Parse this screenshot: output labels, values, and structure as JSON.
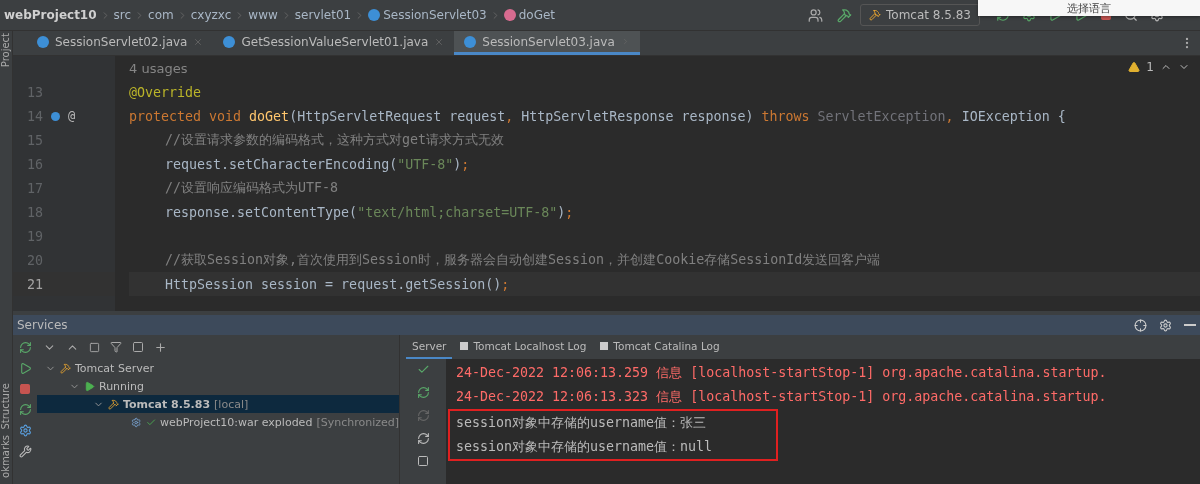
{
  "breadcrumbs": [
    {
      "label": "webProject10",
      "kind": "project"
    },
    {
      "label": "src",
      "kind": "folder"
    },
    {
      "label": "com",
      "kind": "folder"
    },
    {
      "label": "cxyzxc",
      "kind": "folder"
    },
    {
      "label": "www",
      "kind": "folder"
    },
    {
      "label": "servlet01",
      "kind": "folder"
    },
    {
      "label": "SessionServlet03",
      "kind": "class"
    },
    {
      "label": "doGet",
      "kind": "method"
    }
  ],
  "run_config": "Tomcat 8.5.83",
  "popup": {
    "text": "选择语言"
  },
  "left_strip": {
    "top": "Project",
    "bottom": [
      "Structure",
      "okmarks"
    ]
  },
  "tabs": [
    {
      "label": "SessionServlet02.java",
      "selected": false
    },
    {
      "label": "GetSessionValueServlet01.java",
      "selected": false
    },
    {
      "label": "SessionServlet03.java",
      "selected": true
    }
  ],
  "editor": {
    "usages": "4 usages",
    "warnings": "1",
    "lines": [
      {
        "number": "13",
        "current": false,
        "nested": false,
        "segments": [
          {
            "kind": "annotation",
            "text": "@Override"
          }
        ]
      },
      {
        "number": "14",
        "current": false,
        "nested": false,
        "gutter_mark": "@",
        "segments": [
          {
            "kind": "keyword",
            "text": "protected void "
          },
          {
            "kind": "method",
            "text": "doGet"
          },
          {
            "kind": "plain",
            "text": "(HttpServletRequest request"
          },
          {
            "kind": "keyword",
            "text": ", "
          },
          {
            "kind": "plain",
            "text": "HttpServletResponse response) "
          },
          {
            "kind": "keyword",
            "text": "throws "
          },
          {
            "kind": "muted",
            "text": "ServletException"
          },
          {
            "kind": "keyword",
            "text": ", "
          },
          {
            "kind": "plain",
            "text": "IOException {"
          }
        ]
      },
      {
        "number": "15",
        "current": false,
        "nested": true,
        "segments": [
          {
            "kind": "comment",
            "text": "//设置请求参数的编码格式，这种方式对get请求方式无效"
          }
        ]
      },
      {
        "number": "16",
        "current": false,
        "nested": true,
        "segments": [
          {
            "kind": "plain",
            "text": "request.setCharacterEncoding("
          },
          {
            "kind": "string",
            "text": "\"UTF-8\""
          },
          {
            "kind": "plain",
            "text": ")"
          },
          {
            "kind": "keyword",
            "text": ";"
          }
        ]
      },
      {
        "number": "17",
        "current": false,
        "nested": true,
        "segments": [
          {
            "kind": "comment",
            "text": "//设置响应编码格式为UTF-8"
          }
        ]
      },
      {
        "number": "18",
        "current": false,
        "nested": true,
        "segments": [
          {
            "kind": "plain",
            "text": "response.setContentType("
          },
          {
            "kind": "string",
            "text": "\"text/html;charset=UTF-8\""
          },
          {
            "kind": "plain",
            "text": ")"
          },
          {
            "kind": "keyword",
            "text": ";"
          }
        ]
      },
      {
        "number": "19",
        "current": false
      },
      {
        "number": "20",
        "current": false,
        "nested": true,
        "segments": [
          {
            "kind": "comment",
            "text": "//获取Session对象,首次使用到Session时，服务器会自动创建Session，并创建Cookie存储SessionId发送回客户端"
          }
        ]
      },
      {
        "number": "21",
        "current": true,
        "nested": true,
        "segments": [
          {
            "kind": "plain",
            "text": "HttpSession session = request.getSession()"
          },
          {
            "kind": "keyword",
            "text": ";"
          }
        ]
      }
    ]
  },
  "services": {
    "title": "Services",
    "tree": [
      {
        "label": "Tomcat Server",
        "kind": "server",
        "expanded": true,
        "selected": false,
        "children": [
          {
            "label": "Running",
            "kind": "running",
            "expanded": true,
            "selected": false,
            "children": [
              {
                "label": "Tomcat 8.5.83",
                "suffix": "[local]",
                "kind": "tomcat",
                "expanded": true,
                "selected": true,
                "children": [
                  {
                    "label": "webProject10:war exploded",
                    "suffix": "[Synchronized]",
                    "kind": "artifact",
                    "selected": false
                  }
                ]
              }
            ]
          }
        ]
      }
    ],
    "log_tabs": [
      {
        "label": "Server",
        "selected": true,
        "kind": "server"
      },
      {
        "label": "Tomcat Localhost Log",
        "selected": false,
        "kind": "log"
      },
      {
        "label": "Tomcat Catalina Log",
        "selected": false,
        "kind": "log"
      }
    ],
    "log": [
      {
        "text": "24-Dec-2022 12:06:13.259 信息 [localhost-startStop-1] org.apache.catalina.startup.",
        "kind": "error",
        "boxed": false
      },
      {
        "text": "24-Dec-2022 12:06:13.323 信息 [localhost-startStop-1] org.apache.catalina.startup.",
        "kind": "error",
        "boxed": false
      },
      {
        "text": "session对象中存储的username值：张三",
        "kind": "output",
        "boxed": true
      },
      {
        "text": "session对象中存储的username值：null",
        "kind": "output",
        "boxed": true
      }
    ]
  }
}
